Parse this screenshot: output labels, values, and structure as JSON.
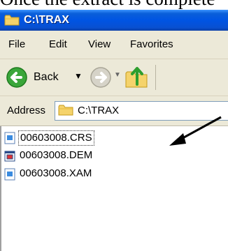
{
  "caption_text": "Once the extract is complete",
  "window": {
    "title": "C:\\TRAX"
  },
  "menu": [
    "File",
    "Edit",
    "View",
    "Favorites"
  ],
  "toolbar": {
    "back_label": "Back",
    "back_icon": "green-left-arrow",
    "forward_icon": "gray-right-arrow",
    "up_icon": "folder-up-arrow"
  },
  "address": {
    "label": "Address",
    "value": "C:\\TRAX"
  },
  "files": [
    {
      "name": "00603008.CRS",
      "icon": "document-icon",
      "selected": true
    },
    {
      "name": "00603008.DEM",
      "icon": "dem-icon",
      "selected": false
    },
    {
      "name": "00603008.XAM",
      "icon": "document-icon",
      "selected": false
    }
  ],
  "colors": {
    "titlebar": "#0054e3",
    "chrome": "#ece9d8",
    "back_green": "#3aa63a",
    "arrow": "#000000"
  }
}
